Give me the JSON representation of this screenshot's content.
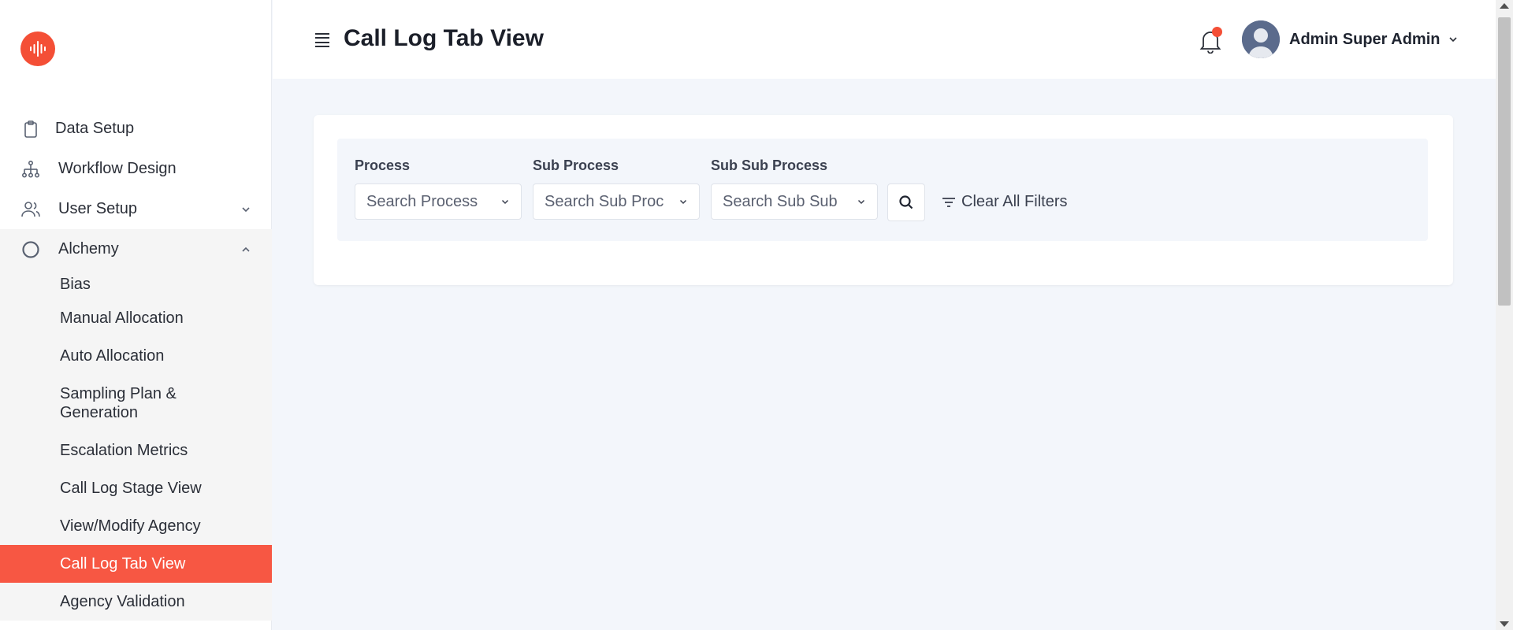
{
  "app": {
    "logo_icon": "audio-wave-icon",
    "accent_color": "#f44f36"
  },
  "sidebar": {
    "items": [
      {
        "label": "Data Setup",
        "icon": "clipboard-icon"
      },
      {
        "label": "Workflow Design",
        "icon": "hierarchy-icon"
      },
      {
        "label": "User Setup",
        "icon": "users-icon",
        "expandable": true
      },
      {
        "label": "Alchemy",
        "icon": "circle-icon",
        "expanded": true
      }
    ],
    "alchemy_sub": [
      {
        "label": "Bias"
      },
      {
        "label": "Manual Allocation"
      },
      {
        "label": "Auto Allocation"
      },
      {
        "label": "Sampling Plan & Generation"
      },
      {
        "label": "Escalation Metrics"
      },
      {
        "label": "Call Log Stage View"
      },
      {
        "label": "View/Modify Agency"
      },
      {
        "label": "Call Log Tab View",
        "active": true
      },
      {
        "label": "Agency Validation"
      }
    ]
  },
  "header": {
    "title": "Call Log Tab View",
    "user_name": "Admin Super Admin",
    "notification_icon": "bell-icon"
  },
  "filters": {
    "process": {
      "label": "Process",
      "placeholder": "Search Process"
    },
    "sub_process": {
      "label": "Sub Process",
      "placeholder": "Search Sub Proc"
    },
    "sub_sub_process": {
      "label": "Sub Sub Process",
      "placeholder": "Search Sub Sub"
    },
    "search_icon": "search-icon",
    "clear_label": "Clear All Filters"
  }
}
